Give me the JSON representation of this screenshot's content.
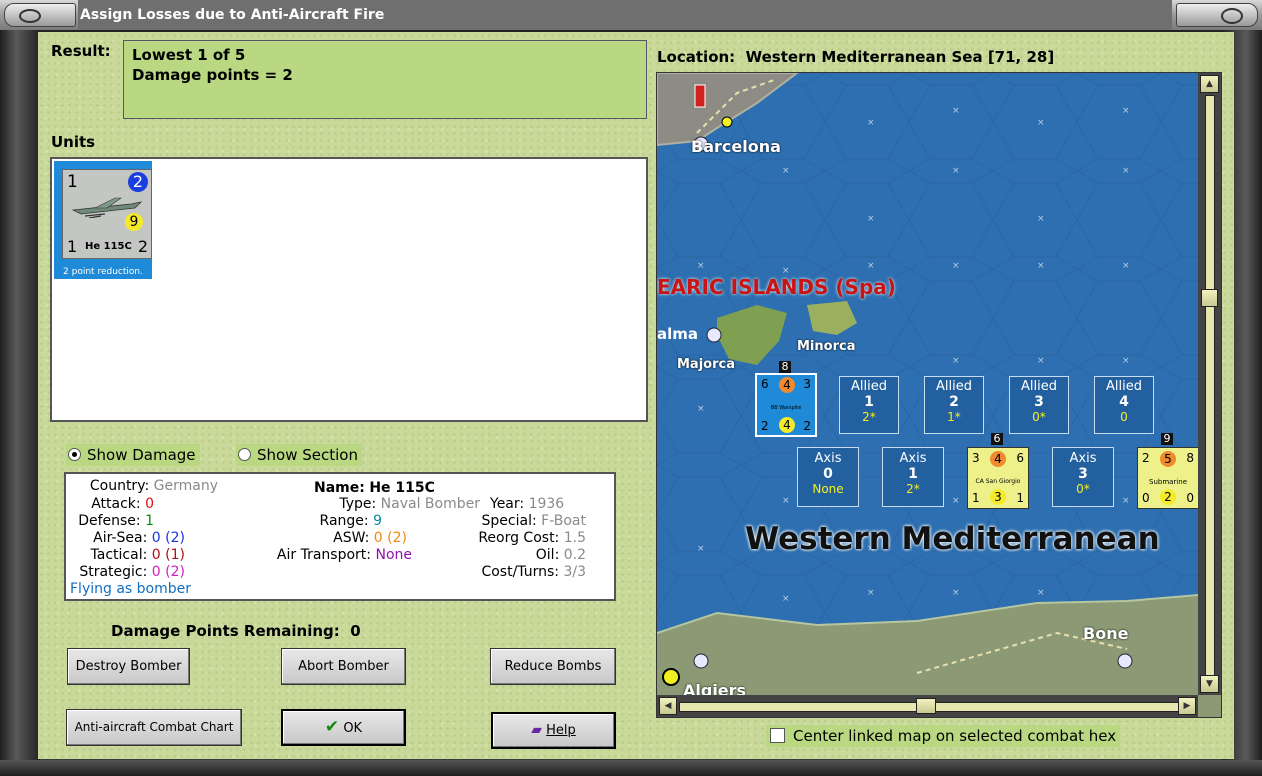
{
  "window": {
    "title": "Assign Losses due to Anti-Aircraft Fire"
  },
  "result": {
    "label": "Result:",
    "line1": "Lowest 1 of 5",
    "line2": "Damage points = 2"
  },
  "units": {
    "label": "Units",
    "card": {
      "attack": "1",
      "defense_circle": "2",
      "bomb_circle": "9",
      "bottom_left": "1",
      "bottom_right": "2",
      "name": "He 115C",
      "caption": "2 point reduction."
    }
  },
  "view_options": {
    "show_damage": "Show Damage",
    "show_section": "Show Section",
    "selected": "show_damage"
  },
  "info": {
    "country_k": "Country:",
    "country_v": "Germany",
    "attack_k": "Attack:",
    "attack_v": "0",
    "defense_k": "Defense:",
    "defense_v": "1",
    "airsea_k": "Air-Sea:",
    "airsea_v": "0",
    "airsea_p": "(2)",
    "tactical_k": "Tactical:",
    "tactical_v": "0",
    "tactical_p": "(1)",
    "strategic_k": "Strategic:",
    "strategic_v": "0",
    "strategic_p": "(2)",
    "flying": "Flying as bomber",
    "name_k": "Name:",
    "name_v": "He 115C",
    "type_k": "Type:",
    "type_v": "Naval Bomber",
    "year_k": "Year:",
    "year_v": "1936",
    "range_k": "Range:",
    "range_v": "9",
    "special_k": "Special:",
    "special_v": "F-Boat",
    "asw_k": "ASW:",
    "asw_v": "0",
    "asw_p": "(2)",
    "reorg_k": "Reorg Cost:",
    "reorg_v": "1.5",
    "airtrans_k": "Air Transport:",
    "airtrans_v": "None",
    "oil_k": "Oil:",
    "oil_v": "0.2",
    "cost_k": "Cost/Turns:",
    "cost_v": "3/3"
  },
  "damage": {
    "label": "Damage Points Remaining:",
    "value": "0"
  },
  "buttons": {
    "destroy": "Destroy Bomber",
    "abort": "Abort Bomber",
    "reduce": "Reduce Bombs",
    "chart": "Anti-aircraft Combat Chart",
    "ok": "OK",
    "help": "Help"
  },
  "location": {
    "label": "Location:",
    "value": "Western Mediterranean Sea [71, 28]"
  },
  "map": {
    "barcelona": "Barcelona",
    "balearic": "EARIC ISLANDS (Spa)",
    "palma": "alma",
    "majorca": "Majorca",
    "minorca": "Minorca",
    "sea_name": "Western Mediterranean",
    "bone": "Bone",
    "algiers": "Algiers",
    "allied_boxes": [
      {
        "label": "Allied",
        "num": "1",
        "sub": "2*"
      },
      {
        "label": "Allied",
        "num": "2",
        "sub": "1*"
      },
      {
        "label": "Allied",
        "num": "3",
        "sub": "0*"
      },
      {
        "label": "Allied",
        "num": "4",
        "sub": "0"
      }
    ],
    "axis_boxes": [
      {
        "label": "Axis",
        "num": "0",
        "sub": "None"
      },
      {
        "label": "Axis",
        "num": "1",
        "sub": "2*"
      },
      {
        "label": "Axis",
        "num": "3",
        "sub": "0*"
      }
    ],
    "warspite": {
      "stack": "8",
      "tl": "6",
      "center": "4",
      "tr": "3",
      "name": "BB Warspite",
      "bl": "2",
      "bc": "4",
      "br": "2"
    },
    "giorgio": {
      "stack": "6",
      "tl": "3",
      "center": "4",
      "tr": "6",
      "name": "CA San Giorgio",
      "bl": "1",
      "bc": "3",
      "br": "1"
    },
    "submarine": {
      "stack": "9",
      "tl": "2",
      "center": "5",
      "tr": "8",
      "name": "Submarine",
      "bl": "0",
      "bc": "2",
      "br": "0"
    }
  },
  "center_linked": "Center linked map on selected combat hex"
}
